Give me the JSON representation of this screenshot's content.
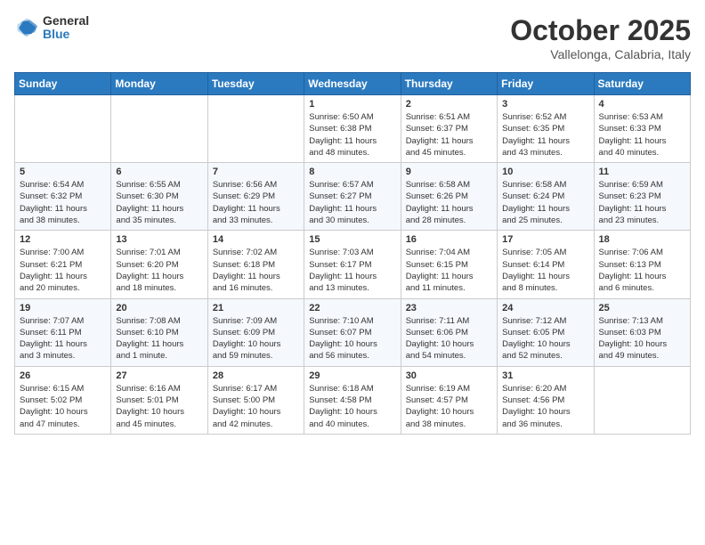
{
  "header": {
    "logo_general": "General",
    "logo_blue": "Blue",
    "month_title": "October 2025",
    "subtitle": "Vallelonga, Calabria, Italy"
  },
  "days_of_week": [
    "Sunday",
    "Monday",
    "Tuesday",
    "Wednesday",
    "Thursday",
    "Friday",
    "Saturday"
  ],
  "weeks": [
    [
      {
        "day": "",
        "info": ""
      },
      {
        "day": "",
        "info": ""
      },
      {
        "day": "",
        "info": ""
      },
      {
        "day": "1",
        "info": "Sunrise: 6:50 AM\nSunset: 6:38 PM\nDaylight: 11 hours\nand 48 minutes."
      },
      {
        "day": "2",
        "info": "Sunrise: 6:51 AM\nSunset: 6:37 PM\nDaylight: 11 hours\nand 45 minutes."
      },
      {
        "day": "3",
        "info": "Sunrise: 6:52 AM\nSunset: 6:35 PM\nDaylight: 11 hours\nand 43 minutes."
      },
      {
        "day": "4",
        "info": "Sunrise: 6:53 AM\nSunset: 6:33 PM\nDaylight: 11 hours\nand 40 minutes."
      }
    ],
    [
      {
        "day": "5",
        "info": "Sunrise: 6:54 AM\nSunset: 6:32 PM\nDaylight: 11 hours\nand 38 minutes."
      },
      {
        "day": "6",
        "info": "Sunrise: 6:55 AM\nSunset: 6:30 PM\nDaylight: 11 hours\nand 35 minutes."
      },
      {
        "day": "7",
        "info": "Sunrise: 6:56 AM\nSunset: 6:29 PM\nDaylight: 11 hours\nand 33 minutes."
      },
      {
        "day": "8",
        "info": "Sunrise: 6:57 AM\nSunset: 6:27 PM\nDaylight: 11 hours\nand 30 minutes."
      },
      {
        "day": "9",
        "info": "Sunrise: 6:58 AM\nSunset: 6:26 PM\nDaylight: 11 hours\nand 28 minutes."
      },
      {
        "day": "10",
        "info": "Sunrise: 6:58 AM\nSunset: 6:24 PM\nDaylight: 11 hours\nand 25 minutes."
      },
      {
        "day": "11",
        "info": "Sunrise: 6:59 AM\nSunset: 6:23 PM\nDaylight: 11 hours\nand 23 minutes."
      }
    ],
    [
      {
        "day": "12",
        "info": "Sunrise: 7:00 AM\nSunset: 6:21 PM\nDaylight: 11 hours\nand 20 minutes."
      },
      {
        "day": "13",
        "info": "Sunrise: 7:01 AM\nSunset: 6:20 PM\nDaylight: 11 hours\nand 18 minutes."
      },
      {
        "day": "14",
        "info": "Sunrise: 7:02 AM\nSunset: 6:18 PM\nDaylight: 11 hours\nand 16 minutes."
      },
      {
        "day": "15",
        "info": "Sunrise: 7:03 AM\nSunset: 6:17 PM\nDaylight: 11 hours\nand 13 minutes."
      },
      {
        "day": "16",
        "info": "Sunrise: 7:04 AM\nSunset: 6:15 PM\nDaylight: 11 hours\nand 11 minutes."
      },
      {
        "day": "17",
        "info": "Sunrise: 7:05 AM\nSunset: 6:14 PM\nDaylight: 11 hours\nand 8 minutes."
      },
      {
        "day": "18",
        "info": "Sunrise: 7:06 AM\nSunset: 6:13 PM\nDaylight: 11 hours\nand 6 minutes."
      }
    ],
    [
      {
        "day": "19",
        "info": "Sunrise: 7:07 AM\nSunset: 6:11 PM\nDaylight: 11 hours\nand 3 minutes."
      },
      {
        "day": "20",
        "info": "Sunrise: 7:08 AM\nSunset: 6:10 PM\nDaylight: 11 hours\nand 1 minute."
      },
      {
        "day": "21",
        "info": "Sunrise: 7:09 AM\nSunset: 6:09 PM\nDaylight: 10 hours\nand 59 minutes."
      },
      {
        "day": "22",
        "info": "Sunrise: 7:10 AM\nSunset: 6:07 PM\nDaylight: 10 hours\nand 56 minutes."
      },
      {
        "day": "23",
        "info": "Sunrise: 7:11 AM\nSunset: 6:06 PM\nDaylight: 10 hours\nand 54 minutes."
      },
      {
        "day": "24",
        "info": "Sunrise: 7:12 AM\nSunset: 6:05 PM\nDaylight: 10 hours\nand 52 minutes."
      },
      {
        "day": "25",
        "info": "Sunrise: 7:13 AM\nSunset: 6:03 PM\nDaylight: 10 hours\nand 49 minutes."
      }
    ],
    [
      {
        "day": "26",
        "info": "Sunrise: 6:15 AM\nSunset: 5:02 PM\nDaylight: 10 hours\nand 47 minutes."
      },
      {
        "day": "27",
        "info": "Sunrise: 6:16 AM\nSunset: 5:01 PM\nDaylight: 10 hours\nand 45 minutes."
      },
      {
        "day": "28",
        "info": "Sunrise: 6:17 AM\nSunset: 5:00 PM\nDaylight: 10 hours\nand 42 minutes."
      },
      {
        "day": "29",
        "info": "Sunrise: 6:18 AM\nSunset: 4:58 PM\nDaylight: 10 hours\nand 40 minutes."
      },
      {
        "day": "30",
        "info": "Sunrise: 6:19 AM\nSunset: 4:57 PM\nDaylight: 10 hours\nand 38 minutes."
      },
      {
        "day": "31",
        "info": "Sunrise: 6:20 AM\nSunset: 4:56 PM\nDaylight: 10 hours\nand 36 minutes."
      },
      {
        "day": "",
        "info": ""
      }
    ]
  ]
}
